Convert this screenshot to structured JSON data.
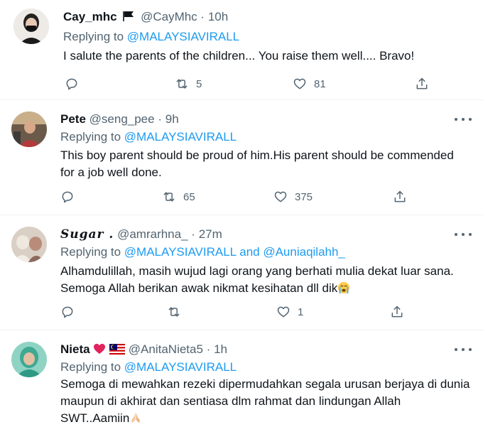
{
  "tweets": [
    {
      "name": "Cay_mhc",
      "handle": "@CayMhc",
      "dot": "·",
      "time": "10h",
      "replying_prefix": "Replying to ",
      "replying_to": "@MALAYSIAVIRALL",
      "text": "I salute the parents of the children... You raise them well.... Bravo!",
      "retweets": "5",
      "likes": "81",
      "flag_icon": "black-flag-icon"
    },
    {
      "name": "Pete",
      "handle": "@seng_pee",
      "dot": "·",
      "time": "9h",
      "replying_prefix": "Replying to ",
      "replying_to": "@MALAYSIAVIRALL",
      "text_line1": "This boy parent should be proud of him.His parent should be commended",
      "text_line2": "for a job well done.",
      "retweets": "65",
      "likes": "375"
    },
    {
      "name": "𝑺𝒖𝒈𝒂𝒓 .",
      "handle": "@amrarhna_",
      "dot": "·",
      "time": "27m",
      "replying_prefix": "Replying to ",
      "replying_to": "@MALAYSIAVIRALL",
      "and_word": " and ",
      "replying_to_2": "@Auniaqilahh_",
      "text_line1": "Alhamdulillah, masih wujud lagi orang yang berhati mulia dekat luar sana.",
      "text_line2": "Semoga Allah berikan awak nikmat kesihatan dll dik",
      "text_emoji": "crying-face-emoji",
      "retweets": "",
      "likes": "1"
    },
    {
      "name": "Nieta",
      "name_emoji": "red-heart-and-malaysia-flag",
      "handle": "@AnitaNieta5",
      "dot": "·",
      "time": "1h",
      "replying_prefix": "Replying to ",
      "replying_to": "@MALAYSIAVIRALL",
      "text_line1": "Semoga di mewahkan rezeki dipermudahkan segala urusan berjaya di dunia",
      "text_line2": "maupun di akhirat dan sentiasa dlm rahmat dan lindungan Allah",
      "text_line3": "SWT..Aamiin",
      "text_emoji": "folded-hands-emoji"
    }
  ],
  "colors": {
    "link": "#1d9bf0",
    "muted": "#536471",
    "text": "#0f1419",
    "divider": "#eff3f4"
  }
}
